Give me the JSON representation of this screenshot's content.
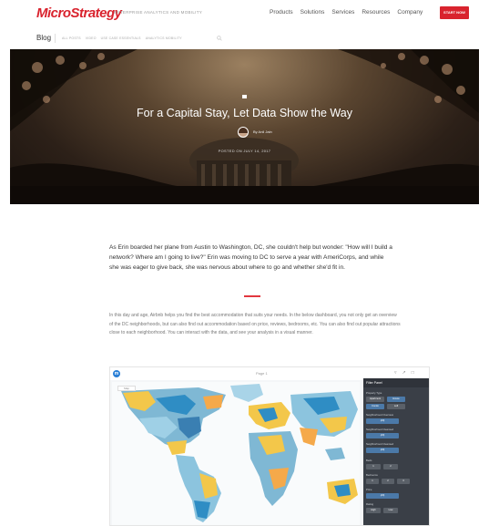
{
  "header": {
    "logo": "MicroStrategy",
    "tagline": "ENTERPRISE ANALYTICS AND MOBILITY",
    "nav": [
      "Products",
      "Solutions",
      "Services",
      "Resources",
      "Company"
    ],
    "cta_label": "START NOW",
    "brand_color": "#d9232e"
  },
  "subnav": {
    "blog_label": "Blog",
    "items": [
      "ALL POSTS",
      "VIDEO",
      "USE CASE ESSENTIALS",
      "ANALYTICS MOBILITY"
    ],
    "search_icon": "search-icon"
  },
  "hero": {
    "title": "For a Capital Stay, Let Data Show the Way",
    "author": "By Anil Jain",
    "posted_on": "POSTED ON JULY 14, 2017"
  },
  "article": {
    "intro": "As Erin boarded her plane from Austin to Washington, DC, she couldn't help but wonder: \"How will I build a network? Where am I going to live?\" Erin was moving to DC to serve a year with AmeriCorps, and while she was eager to give back, she was nervous about where to go and whether she'd fit in.",
    "body": "In this day and age, Airbnb helps you find the best accommodation that suits your needs. In the below dashboard, you not only get an overview of the DC neighborhoods, but can also find out accommodation based on price, reviews, bedrooms, etc. You can also find out popular attractions close to each neighborhood. You can interact with the data, and see your analysis in a visual manner.",
    "accent_color": "#e2373f"
  },
  "dashboard": {
    "page_title": "Page 1",
    "map_tab": "Map",
    "filter_panel": {
      "header": "Filter Panel",
      "sections": [
        {
          "label": "Property Type",
          "chips": [
            "Apartment",
            "House",
            "Condo",
            "Loft"
          ]
        },
        {
          "label": "Neighborhood Overview",
          "chips": [
            "(All)"
          ]
        },
        {
          "label": "Neighborhood Cleansed",
          "chips": [
            "(All)"
          ]
        },
        {
          "label": "Neighborhood Cleansed",
          "chips": [
            "(All)"
          ]
        },
        {
          "label": "Beds",
          "chips": [
            "1",
            "2"
          ]
        },
        {
          "label": "Bedrooms",
          "chips": [
            "1",
            "2",
            "3"
          ]
        },
        {
          "label": "Price",
          "chips": [
            "(All)"
          ]
        },
        {
          "label": "Rating",
          "chips": [
            "High",
            "Low"
          ]
        }
      ]
    }
  }
}
